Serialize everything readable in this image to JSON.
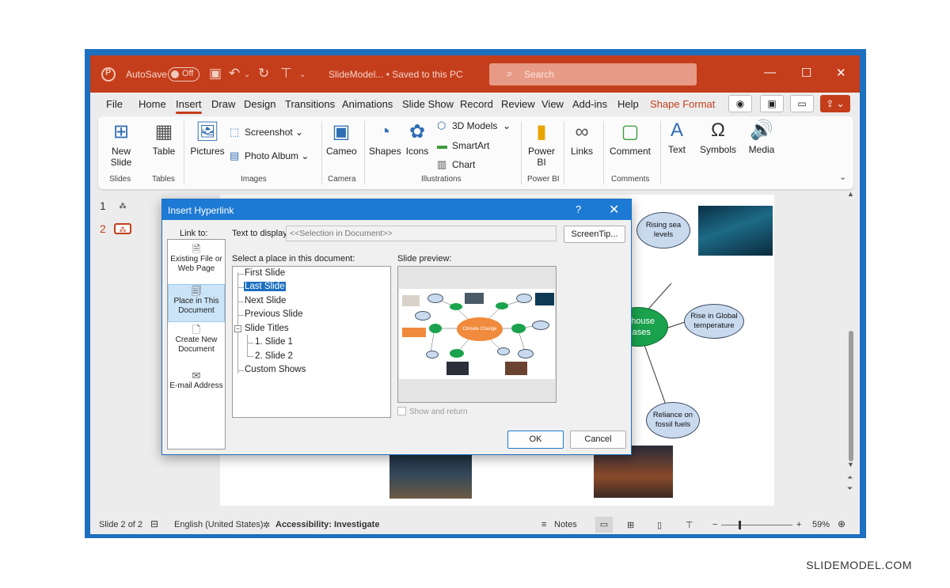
{
  "titlebar": {
    "autosave_label": "AutoSave",
    "autosave_state": "Off",
    "doc_title": "SlideModel... • Saved to this PC",
    "search_placeholder": "Search"
  },
  "menu": {
    "items": [
      "File",
      "Home",
      "Insert",
      "Draw",
      "Design",
      "Transitions",
      "Animations",
      "Slide Show",
      "Record",
      "Review",
      "View",
      "Add-ins",
      "Help",
      "Shape Format"
    ],
    "active": "Insert"
  },
  "ribbon": {
    "new_slide": "New\nSlide",
    "table": "Table",
    "pictures": "Pictures",
    "screenshot": "Screenshot",
    "photo_album": "Photo Album",
    "cameo": "Cameo",
    "shapes": "Shapes",
    "icons": "Icons",
    "models_3d": "3D Models",
    "smartart": "SmartArt",
    "chart": "Chart",
    "power_bi": "Power\nBI",
    "links": "Links",
    "comment": "Comment",
    "text": "Text",
    "symbols": "Symbols",
    "media": "Media",
    "groups": {
      "slides": "Slides",
      "tables": "Tables",
      "images": "Images",
      "camera": "Camera",
      "illustrations": "Illustrations",
      "power_bi": "Power BI",
      "comments": "Comments"
    }
  },
  "slides_panel": {
    "numbers": [
      "1",
      "2"
    ]
  },
  "slide": {
    "bubbles": {
      "sea": "Rising sea levels",
      "temp": "Rise in Global temperature",
      "fossil": "Reliance on fossil fuels",
      "greenhouse": "enhouse Gases"
    }
  },
  "dialog": {
    "title": "Insert Hyperlink",
    "help": "?",
    "close": "✕",
    "link_to_label": "Link to:",
    "link_to": [
      {
        "label": "Existing File or Web Page"
      },
      {
        "label": "Place in This Document"
      },
      {
        "label": "Create New Document"
      },
      {
        "label": "E-mail Address"
      }
    ],
    "text_to_display_label": "Text to display:",
    "text_to_display_value": "<<Selection in Document>>",
    "screentip_button": "ScreenTip...",
    "place_label": "Select a place in this document:",
    "tree": {
      "first": "First Slide",
      "last": "Last Slide",
      "next": "Next Slide",
      "previous": "Previous Slide",
      "titles": "Slide Titles",
      "slide1": "1. Slide 1",
      "slide2": "2. Slide 2",
      "custom": "Custom Shows"
    },
    "preview_label": "Slide preview:",
    "preview_center": "Climate Change",
    "show_return": "Show and return",
    "ok": "OK",
    "cancel": "Cancel"
  },
  "status": {
    "slide_of": "Slide 2 of 2",
    "language": "English (United States)",
    "accessibility": "Accessibility: Investigate",
    "notes": "Notes",
    "zoom": "59%"
  },
  "watermark": "SLIDEMODEL.COM",
  "colors": {
    "accent": "#c43e1c",
    "dialog_blue": "#1d7ad4",
    "frame_blue": "#1d6fbf"
  }
}
